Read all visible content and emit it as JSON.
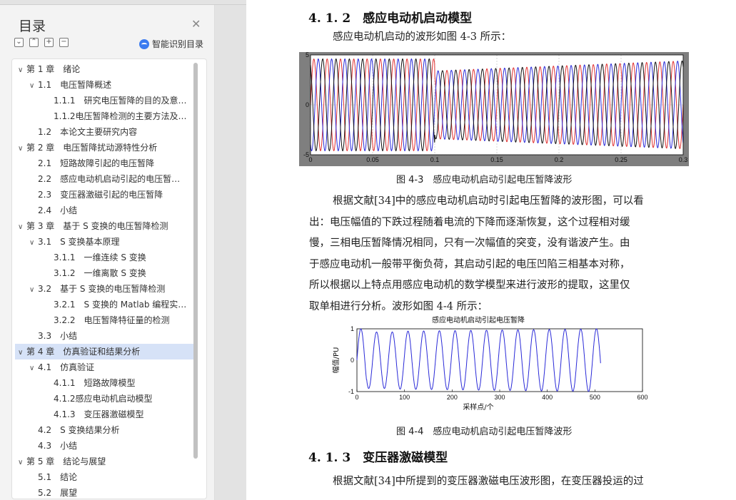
{
  "sidebar": {
    "title": "目录",
    "close_icon": "close-icon",
    "smart_label": "智能识别目录",
    "toc": [
      {
        "level": 0,
        "chev": "v",
        "label": "第 1 章　绪论"
      },
      {
        "level": 1,
        "chev": "v",
        "label": "1.1　电压暂降概述"
      },
      {
        "level": 2,
        "chev": "",
        "label": "1.1.1　研究电压暂降的目的及意…"
      },
      {
        "level": 2,
        "chev": "",
        "label": "1.1.2电压暂降检测的主要方法及…"
      },
      {
        "level": 1,
        "chev": "",
        "label": "1.2　本论文主要研究内容"
      },
      {
        "level": 0,
        "chev": "v",
        "label": "第 2 章　电压暂降扰动源特性分析"
      },
      {
        "level": 1,
        "chev": "",
        "label": "2.1　短路故障引起的电压暂降"
      },
      {
        "level": 1,
        "chev": "",
        "label": "2.2　感应电动机启动引起的电压暂…"
      },
      {
        "level": 1,
        "chev": "",
        "label": "2.3　变压器激磁引起的电压暂降"
      },
      {
        "level": 1,
        "chev": "",
        "label": "2.4　小结"
      },
      {
        "level": 0,
        "chev": "v",
        "label": "第 3 章　基于 S 变换的电压暂降检测"
      },
      {
        "level": 1,
        "chev": "v",
        "label": "3.1　S 变换基本原理"
      },
      {
        "level": 2,
        "chev": "",
        "label": "3.1.1　一维连续 S 变换"
      },
      {
        "level": 2,
        "chev": "",
        "label": "3.1.2　一维离散 S 变换"
      },
      {
        "level": 1,
        "chev": "v",
        "label": "3.2　基于 S 变换的电压暂降检测"
      },
      {
        "level": 2,
        "chev": "",
        "label": "3.2.1　S 变换的 Matlab 编程实…"
      },
      {
        "level": 2,
        "chev": "",
        "label": "3.2.2　电压暂降特征量的检测"
      },
      {
        "level": 1,
        "chev": "",
        "label": "3.3　小结"
      },
      {
        "level": 0,
        "chev": "v",
        "label": "第 4 章　仿真验证和结果分析",
        "selected": true
      },
      {
        "level": 1,
        "chev": "v",
        "label": "4.1　仿真验证"
      },
      {
        "level": 2,
        "chev": "",
        "label": "4.1.1　短路故障模型"
      },
      {
        "level": 2,
        "chev": "",
        "label": "4.1.2感应电动机启动模型"
      },
      {
        "level": 2,
        "chev": "",
        "label": "4.1.3　变压器激磁模型"
      },
      {
        "level": 1,
        "chev": "",
        "label": "4.2　S 变换结果分析"
      },
      {
        "level": 1,
        "chev": "",
        "label": "4.3　小结"
      },
      {
        "level": 0,
        "chev": "v",
        "label": "第 5 章　结论与展望"
      },
      {
        "level": 1,
        "chev": "",
        "label": "5.1　结论"
      },
      {
        "level": 1,
        "chev": "",
        "label": "5.2　展望"
      }
    ]
  },
  "doc": {
    "h_412": "4. 1. 2　感应电动机启动模型",
    "intro": "感应电动机启动的波形如图 4-3 所示：",
    "cap43": "图 4-3　感应电动机启动引起电压暂降波形",
    "para_lines": [
      "根据文献[34]中的感应电动机启动时引起电压暂降的波形图，可以看",
      "出：电压幅值的下跌过程随着电流的下降而逐渐恢复，这个过程相对缓",
      "慢，三相电压暂降情况相同，只有一次幅值的突变，没有谐波产生。由",
      "于感应电动机一般带平衡负荷，其启动引起的电压凹陷三相基本对称，",
      "所以根据以上特点用感应电动机的数学模型来进行波形的提取，这里仅",
      "取单相进行分析。波形如图 4-4 所示："
    ],
    "cap44": "图 4-4　感应电动机启动引起电压暂降波形",
    "h_413": "4. 1. 3　变压器激磁模型",
    "para2": "根据文献[34]中所提到的变压器激磁电压波形图，在变压器投运的过"
  },
  "chart_data": [
    {
      "type": "line",
      "title": "",
      "x_ticks": [
        "0",
        "0.05",
        "0.1",
        "0.15",
        "0.2",
        "0.25",
        "0.3"
      ],
      "y_ticks": [
        "5",
        "0",
        "-5"
      ],
      "xlim": [
        0,
        0.3
      ],
      "ylim": [
        -5,
        5
      ],
      "series_colors": [
        "#e03030",
        "#2a2ad8",
        "#111111"
      ],
      "note_visible": "three-phase sinusoid, amplitude drops near x=0.1 then slowly recovers"
    },
    {
      "type": "line",
      "title": "感应电动机启动引起电压暂降",
      "xlabel": "采样点/个",
      "ylabel": "幅值/PU",
      "x_ticks": [
        "0",
        "100",
        "200",
        "300",
        "400",
        "500",
        "600"
      ],
      "y_ticks": [
        "1",
        "0",
        "-1"
      ],
      "xlim": [
        0,
        600
      ],
      "ylim": [
        -1,
        1
      ],
      "series_color": "#2a2ad8"
    }
  ]
}
